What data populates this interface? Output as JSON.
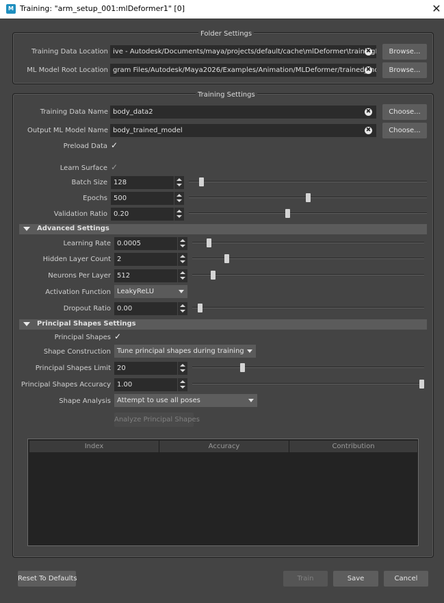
{
  "window": {
    "app_icon": "M",
    "title": "Training: \"arm_setup_001:mlDeformer1\" [0]",
    "close": "✕"
  },
  "folder_settings": {
    "title": "Folder Settings",
    "training_data_location": {
      "label": "Training Data Location",
      "value": "ive - Autodesk/Documents/maya/projects/default/cache\\mlDeformer\\trainingData",
      "button": "Browse..."
    },
    "ml_model_root_location": {
      "label": "ML Model Root Location",
      "value": "gram Files/Autodesk/Maya2026/Examples/Animation/MLDeformer/trained_models",
      "button": "Browse..."
    }
  },
  "training_settings": {
    "title": "Training Settings",
    "training_data_name": {
      "label": "Training Data Name",
      "value": "body_data2",
      "button": "Choose..."
    },
    "output_ml_model_name": {
      "label": "Output ML Model Name",
      "value": "body_trained_model",
      "button": "Choose..."
    },
    "preload_data": {
      "label": "Preload Data",
      "checked": true
    },
    "learn_surface": {
      "label": "Learn Surface",
      "checked": true,
      "enabled": false
    },
    "batch_size": {
      "label": "Batch Size",
      "value": "128",
      "slider_fraction": 0.02
    },
    "epochs": {
      "label": "Epochs",
      "value": "500",
      "slider_fraction": 0.49
    },
    "validation_ratio": {
      "label": "Validation Ratio",
      "value": "0.20",
      "slider_fraction": 0.4
    }
  },
  "advanced_settings": {
    "title": "Advanced Settings",
    "learning_rate": {
      "label": "Learning Rate",
      "value": "0.0005",
      "slider_fraction": 0.04
    },
    "hidden_layer_count": {
      "label": "Hidden Layer Count",
      "value": "2",
      "slider_fraction": 0.12
    },
    "neurons_per_layer": {
      "label": "Neurons Per Layer",
      "value": "512",
      "slider_fraction": 0.06
    },
    "activation_function": {
      "label": "Activation Function",
      "value": "LeakyReLU"
    },
    "dropout_ratio": {
      "label": "Dropout Ratio",
      "value": "0.00",
      "slider_fraction": 0.0
    }
  },
  "principal_shapes_settings": {
    "title": "Principal Shapes Settings",
    "principal_shapes": {
      "label": "Principal Shapes",
      "checked": true
    },
    "shape_construction": {
      "label": "Shape Construction",
      "value": "Tune principal shapes during training"
    },
    "principal_shapes_limit": {
      "label": "Principal Shapes Limit",
      "value": "20",
      "slider_fraction": 0.19
    },
    "principal_shapes_accuracy": {
      "label": "Principal Shapes Accuracy",
      "value": "1.00",
      "slider_fraction": 1.0
    },
    "shape_analysis": {
      "label": "Shape Analysis",
      "value": "Attempt to use all poses"
    },
    "analyze_button": "Analyze Principal Shapes",
    "table_columns": [
      "Index",
      "Accuracy",
      "Contribution"
    ]
  },
  "footer": {
    "reset": "Reset To Defaults",
    "train": "Train",
    "save": "Save",
    "cancel": "Cancel"
  },
  "icons": {
    "clear": "✖",
    "check": "✓"
  }
}
